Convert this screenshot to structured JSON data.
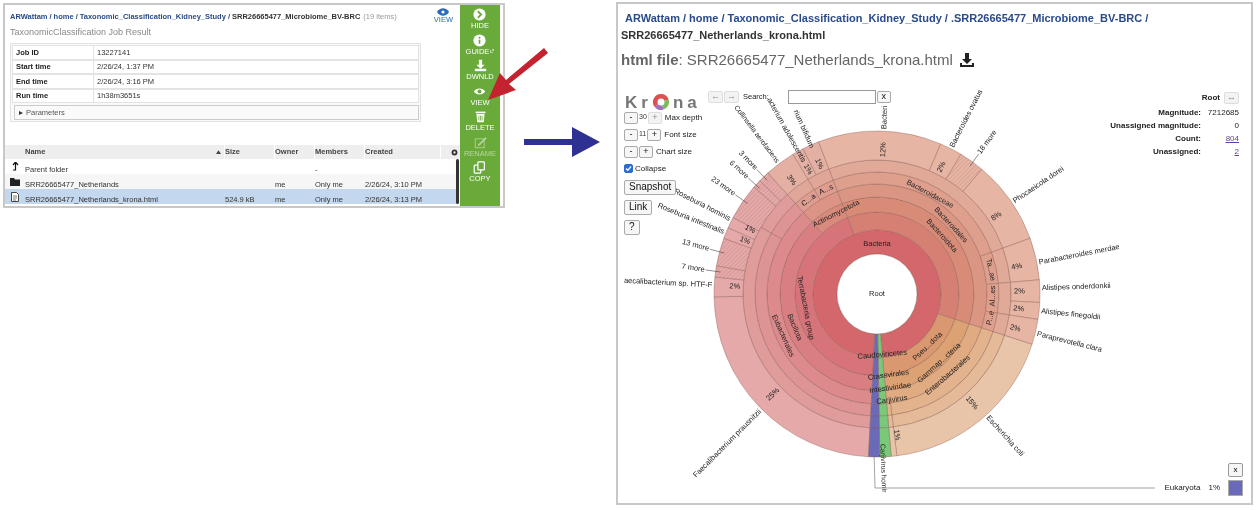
{
  "job_panel": {
    "breadcrumb": {
      "links": [
        "ARWattam",
        "home",
        "Taxonomic_Classification_Kidney_Study"
      ],
      "separator": "/",
      "current": "SRR26665477_Microbiome_BV-BRC",
      "count": "(19 items)"
    },
    "view_button": "VIEW",
    "title": "TaxonomicClassification Job Result",
    "job_rows": [
      {
        "label": "Job ID",
        "value": "13227141"
      },
      {
        "label": "Start time",
        "value": "2/26/24, 1:37 PM"
      },
      {
        "label": "End time",
        "value": "2/26/24, 3:16 PM"
      },
      {
        "label": "Run time",
        "value": "1h38m3651s"
      }
    ],
    "parameters": {
      "label": "Parameters",
      "expanded": false
    },
    "columns": [
      {
        "label": "Name",
        "sorted": true
      },
      {
        "label": "Size",
        "sorted": false
      },
      {
        "label": "Owner",
        "sorted": false
      },
      {
        "label": "Members",
        "sorted": false
      },
      {
        "label": "Created",
        "sorted": false
      }
    ],
    "rows": [
      {
        "kind": "parent",
        "name": "Parent folder",
        "members": "-",
        "selected": false
      },
      {
        "kind": "folder",
        "name": "SRR26665477_Netherlands",
        "owner": "me",
        "members": "Only me",
        "created": "2/26/24, 3:10 PM",
        "selected": false
      },
      {
        "kind": "file",
        "name": "SRR26665477_Netherlands_krona.html",
        "size": "524.9 kB",
        "owner": "me",
        "members": "Only me",
        "created": "2/26/24, 3:13 PM",
        "selected": true
      }
    ],
    "actions": [
      {
        "kind": "hide",
        "label": "HIDE",
        "disabled": false
      },
      {
        "kind": "guide",
        "label": "GUIDE",
        "disabled": false
      },
      {
        "kind": "download",
        "label": "DWNLD",
        "disabled": false
      },
      {
        "kind": "view",
        "label": "VIEW",
        "disabled": false
      },
      {
        "kind": "delete",
        "label": "DELETE",
        "disabled": false
      },
      {
        "kind": "rename",
        "label": "RENAME",
        "disabled": true
      },
      {
        "kind": "copy",
        "label": "COPY",
        "disabled": false
      }
    ]
  },
  "viewer_panel": {
    "breadcrumb": {
      "links": [
        "ARWattam",
        "home",
        "Taxonomic_Classification_Kidney_Study",
        ".SRR26665477_Microbiome_BV-BRC"
      ],
      "separator": "/",
      "current": "SRR26665477_Netherlands_krona.html"
    },
    "file_label": "html file",
    "file_sep": ":",
    "file_name": "SRR26665477_Netherlands_krona.html",
    "krona": {
      "logo": {
        "before": "Kr",
        "after": "na"
      },
      "nav": [
        {
          "label": "←",
          "disabled": true
        },
        {
          "label": "→",
          "disabled": true
        }
      ],
      "search_label": "Search:",
      "search_clear": "x",
      "settings": [
        {
          "kind": "stepper",
          "minus": "-",
          "value": "30",
          "plus": "+",
          "plus_disabled": true,
          "label": "Max depth"
        },
        {
          "kind": "stepper",
          "minus": "-",
          "value": "11",
          "plus": "+",
          "plus_disabled": false,
          "label": "Font size"
        },
        {
          "kind": "stepper",
          "minus": "-",
          "plus": "+",
          "plus_disabled": false,
          "label": "Chart size"
        },
        {
          "kind": "checkbox",
          "label": "Collapse",
          "checked": true
        },
        {
          "kind": "button",
          "label": "Snapshot"
        },
        {
          "kind": "button",
          "label": "Link"
        },
        {
          "kind": "button",
          "label": "?"
        }
      ],
      "focus": {
        "name": "Root",
        "button": "↔",
        "button_disabled": true
      },
      "stats": [
        {
          "label": "Magnitude:",
          "value": "7212685",
          "link": false
        },
        {
          "label": "Unassigned magnitude:",
          "value": "0",
          "link": false
        },
        {
          "label": "Count:",
          "value": "804",
          "link": true
        },
        {
          "label": "Unassigned:",
          "value": "2",
          "link": true
        }
      ],
      "labels": [
        {
          "kind": "name",
          "text": "Bacteri"
        },
        {
          "kind": "percent",
          "text": "12%"
        },
        {
          "kind": "name",
          "text": "Collinsella aerofaciens"
        },
        {
          "kind": "percent",
          "text": "3%"
        },
        {
          "kind": "name",
          "text": "acterium adolescentis"
        },
        {
          "kind": "percent",
          "text": "1%"
        },
        {
          "kind": "name",
          "text": "rium bifidum"
        },
        {
          "kind": "percent",
          "text": "1%"
        },
        {
          "kind": "more",
          "text": "3 more"
        },
        {
          "kind": "more",
          "text": "6 more"
        },
        {
          "kind": "more",
          "text": "23 more"
        },
        {
          "kind": "name",
          "text": "Roseburia hominis"
        },
        {
          "kind": "percent",
          "text": "1%"
        },
        {
          "kind": "name",
          "text": "Roseburia intestinalis"
        },
        {
          "kind": "percent",
          "text": "1%"
        },
        {
          "kind": "more",
          "text": "13 more"
        },
        {
          "kind": "more",
          "text": "7 more"
        },
        {
          "kind": "name",
          "text": "aecalibacterium sp. HTF-F"
        },
        {
          "kind": "percent",
          "text": "2%"
        },
        {
          "kind": "percent",
          "text": "25%"
        },
        {
          "kind": "name",
          "text": "Faecalibacterium prausnitzii"
        },
        {
          "kind": "name",
          "text": "Bacteroides ovatus"
        },
        {
          "kind": "percent",
          "text": "2%"
        },
        {
          "kind": "more",
          "text": "18 more"
        },
        {
          "kind": "percent",
          "text": "8%"
        },
        {
          "kind": "name",
          "text": "Phocaeicola dorei"
        },
        {
          "kind": "percent",
          "text": "4%"
        },
        {
          "kind": "name",
          "text": "Parabacteroides merdae"
        },
        {
          "kind": "percent",
          "text": "2%"
        },
        {
          "kind": "name",
          "text": "Alistipes onderdonkii"
        },
        {
          "kind": "percent",
          "text": "2%"
        },
        {
          "kind": "name",
          "text": "Alistipes finegoldii"
        },
        {
          "kind": "percent",
          "text": "2%"
        },
        {
          "kind": "name",
          "text": "Paraprevotella clara"
        },
        {
          "kind": "percent",
          "text": "15%"
        },
        {
          "kind": "name",
          "text": "Escherichia coli"
        },
        {
          "kind": "percent",
          "text": "1%"
        },
        {
          "kind": "name",
          "text": "Carjivirus homir"
        },
        {
          "kind": "name",
          "text": "Root"
        },
        {
          "kind": "name",
          "text": "Bacteria"
        },
        {
          "kind": "name",
          "text": "Terrabacteria group"
        },
        {
          "kind": "name",
          "text": "Bacillota"
        },
        {
          "kind": "name",
          "text": "Eubacteriales"
        },
        {
          "kind": "name",
          "text": "Actinomycetota"
        },
        {
          "kind": "name",
          "text": "C...a"
        },
        {
          "kind": "name",
          "text": "A...s"
        },
        {
          "kind": "name",
          "text": "Bacteroidaceae"
        },
        {
          "kind": "name",
          "text": "Bacteroidales"
        },
        {
          "kind": "name",
          "text": "Bacteroidota"
        },
        {
          "kind": "name",
          "text": "Ta...ae"
        },
        {
          "kind": "name",
          "text": "Al...es"
        },
        {
          "kind": "name",
          "text": "P...e"
        },
        {
          "kind": "name",
          "text": "Pseu...dota"
        },
        {
          "kind": "name",
          "text": "Gammap...cteria"
        },
        {
          "kind": "name",
          "text": "Enterobacterales"
        },
        {
          "kind": "name",
          "text": "Caudoviricetes"
        },
        {
          "kind": "name",
          "text": "Crassvirales"
        },
        {
          "kind": "name",
          "text": "Intestiviridae"
        },
        {
          "kind": "name",
          "text": "Carjivirus"
        }
      ],
      "legend_close": "x",
      "legend": {
        "name": "Eukaryota",
        "percent": "1%",
        "color": "#6a6ab8"
      }
    }
  }
}
